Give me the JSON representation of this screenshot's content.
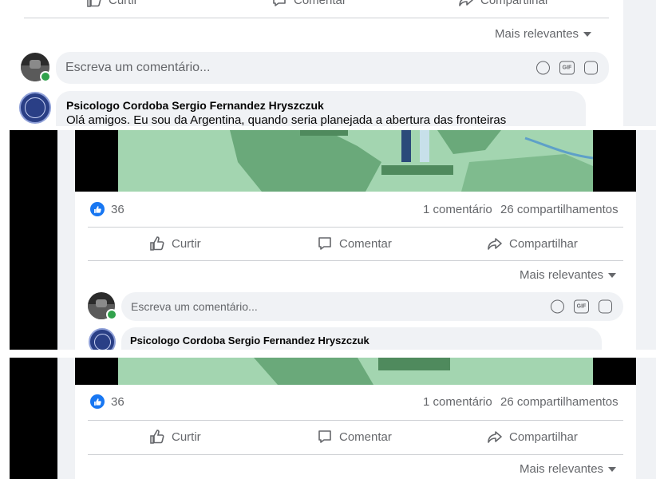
{
  "post": {
    "likes_count": "36",
    "comments_count": "1 comentário",
    "shares_count": "26 compartilhamentos"
  },
  "actions": {
    "like": "Curtir",
    "comment": "Comentar",
    "share": "Compartilhar"
  },
  "comments": {
    "sort_label": "Mais relevantes",
    "input_placeholder": "Escreva um comentário...",
    "gif_label": "GIF",
    "first": {
      "author": "Psicologo Cordoba Sergio Fernandez Hryszczuk",
      "text": "Olá amigos. Eu sou da Argentina, quando seria planejada a abertura das fronteiras"
    }
  },
  "icons": [
    "like-icon",
    "comment-icon",
    "share-icon",
    "emoji-icon",
    "gif-icon",
    "sticker-icon",
    "chevron-down-icon"
  ],
  "colors": {
    "facebook_blue": "#1877f2",
    "online_green": "#31a24c",
    "map_green": "#a3d5b0",
    "map_land": "#6aa97a"
  }
}
